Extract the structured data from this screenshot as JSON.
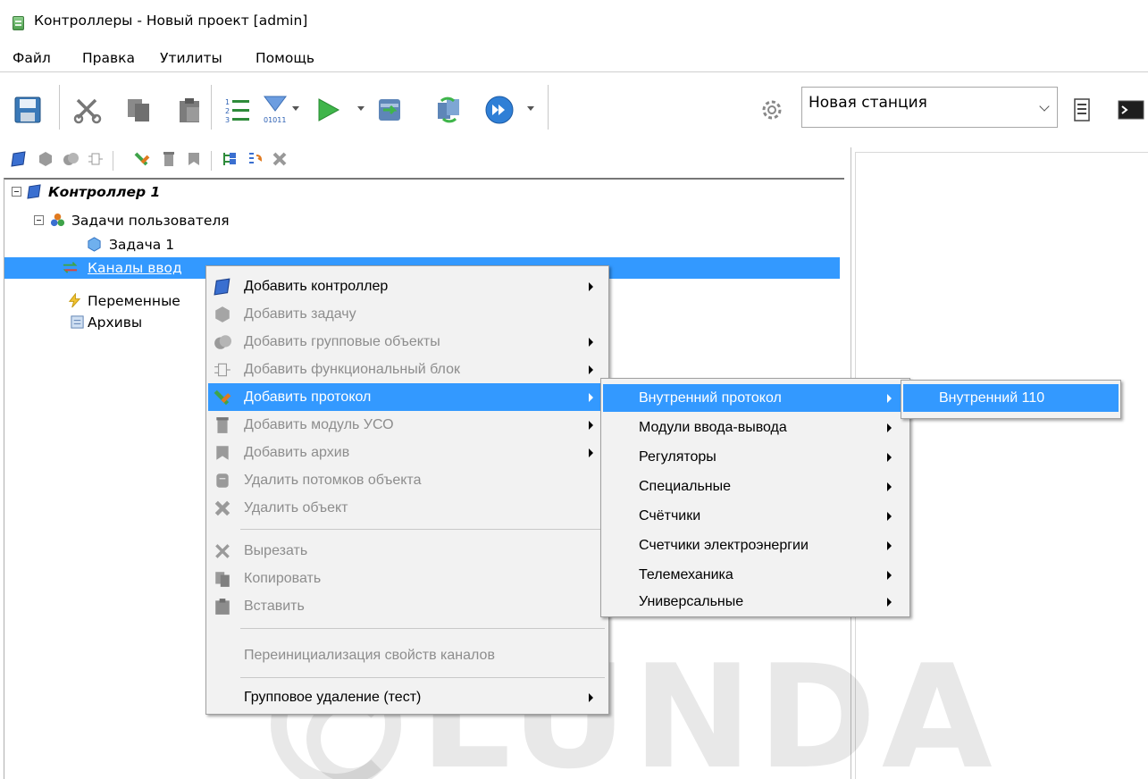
{
  "window": {
    "title": "Контроллеры - Новый проект [admin]"
  },
  "menubar": {
    "items": [
      "Файл",
      "Правка",
      "Утилиты",
      "Помощь"
    ]
  },
  "toolbar": {
    "station_combo": {
      "value": "Новая станция"
    }
  },
  "tree": {
    "root": {
      "label": "Контроллер 1"
    },
    "user_tasks": {
      "label": "Задачи пользователя"
    },
    "task1": {
      "label": "Задача 1"
    },
    "io_channels": {
      "label": "Каналы ввод"
    },
    "variables": {
      "label": "Переменные"
    },
    "archives": {
      "label": "Архивы"
    }
  },
  "context_menu": {
    "items": [
      {
        "label": "Добавить контроллер",
        "enabled": true,
        "submenu": true
      },
      {
        "label": "Добавить задачу",
        "enabled": false,
        "submenu": false
      },
      {
        "label": "Добавить групповые объекты",
        "enabled": false,
        "submenu": true
      },
      {
        "label": "Добавить функциональный блок",
        "enabled": false,
        "submenu": true
      },
      {
        "label": "Добавить протокол",
        "enabled": true,
        "submenu": true,
        "highlighted": true
      },
      {
        "label": "Добавить модуль УСО",
        "enabled": false,
        "submenu": true
      },
      {
        "label": "Добавить архив",
        "enabled": false,
        "submenu": true
      },
      {
        "label": "Удалить потомков объекта",
        "enabled": false,
        "submenu": false
      },
      {
        "label": "Удалить объект",
        "enabled": false,
        "submenu": false
      },
      {
        "label": "Вырезать",
        "enabled": false,
        "submenu": false
      },
      {
        "label": "Копировать",
        "enabled": false,
        "submenu": false
      },
      {
        "label": "Вставить",
        "enabled": false,
        "submenu": false
      },
      {
        "label": "Переинициализация свойств каналов",
        "enabled": false,
        "submenu": false
      },
      {
        "label": "Групповое удаление (тест)",
        "enabled": true,
        "submenu": true
      }
    ]
  },
  "protocol_submenu": {
    "items": [
      {
        "label": "Внутренний протокол",
        "highlighted": true
      },
      {
        "label": "Модули ввода-вывода"
      },
      {
        "label": "Регуляторы"
      },
      {
        "label": "Специальные"
      },
      {
        "label": "Счётчики"
      },
      {
        "label": "Счетчики электроэнергии"
      },
      {
        "label": "Телемеханика"
      },
      {
        "label": "Универсальные"
      }
    ]
  },
  "internal_submenu": {
    "items": [
      {
        "label": "Внутренний 110",
        "highlighted": true
      }
    ]
  },
  "watermark": {
    "text": "LUNDA"
  },
  "colors": {
    "selection": "#3399ff",
    "menu_bg": "#f2f2f2",
    "disabled_text": "#8d8d8d"
  }
}
